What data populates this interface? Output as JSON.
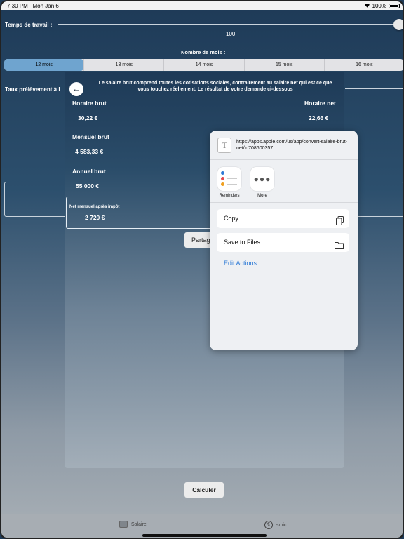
{
  "status_bar": {
    "time": "7:30 PM",
    "date": "Mon Jan 6",
    "battery": "100%"
  },
  "main": {
    "temps_label": "Temps de travail :",
    "temps_value": "100",
    "temps_fraction": 1.0,
    "nombre_mois_label": "Nombre de mois :",
    "segments": [
      "12 mois",
      "13 mois",
      "14 mois",
      "15 mois",
      "16 mois"
    ],
    "selected_segment": "12 mois",
    "taux_label": "Taux prélèvement à l",
    "calculer_label": "Calculer"
  },
  "modal": {
    "back_icon": "arrow-left-icon",
    "description": "Le salaire brut comprend toutes les cotisations sociales, contrairement au salaire net qui est ce que vous touchez réellement. Le résultat de votre demande ci-dessous",
    "horaire_brut_label": "Horaire brut",
    "horaire_brut_value": "30,22 €",
    "horaire_net_label": "Horaire net",
    "horaire_net_value": "22,66 €",
    "mensuel_brut_label": "Mensuel brut",
    "mensuel_brut_value": "4 583,33 €",
    "annuel_brut_label": "Annuel brut",
    "annuel_brut_value": "55 000 €",
    "net_apres_impot_label": "Net mensuel après impôt",
    "net_apres_impot_value": "2 720 €",
    "partager_label": "Partager"
  },
  "share_sheet": {
    "url": "https://apps.apple.com/us/app/convert-salaire-brut-net/id708600357",
    "apps": [
      {
        "label": "Reminders",
        "icon": "reminders-icon"
      },
      {
        "label": "More",
        "icon": "more-icon"
      }
    ],
    "actions": [
      {
        "label": "Copy",
        "icon": "copy-icon"
      },
      {
        "label": "Save to Files",
        "icon": "folder-icon"
      }
    ],
    "edit_actions_label": "Edit Actions...",
    "link_color": "#2f7bd6"
  },
  "tabbar": {
    "tabs": [
      {
        "label": "Salaire",
        "icon": "coins-icon"
      },
      {
        "label": "smic",
        "icon": "euro-icon"
      }
    ]
  }
}
